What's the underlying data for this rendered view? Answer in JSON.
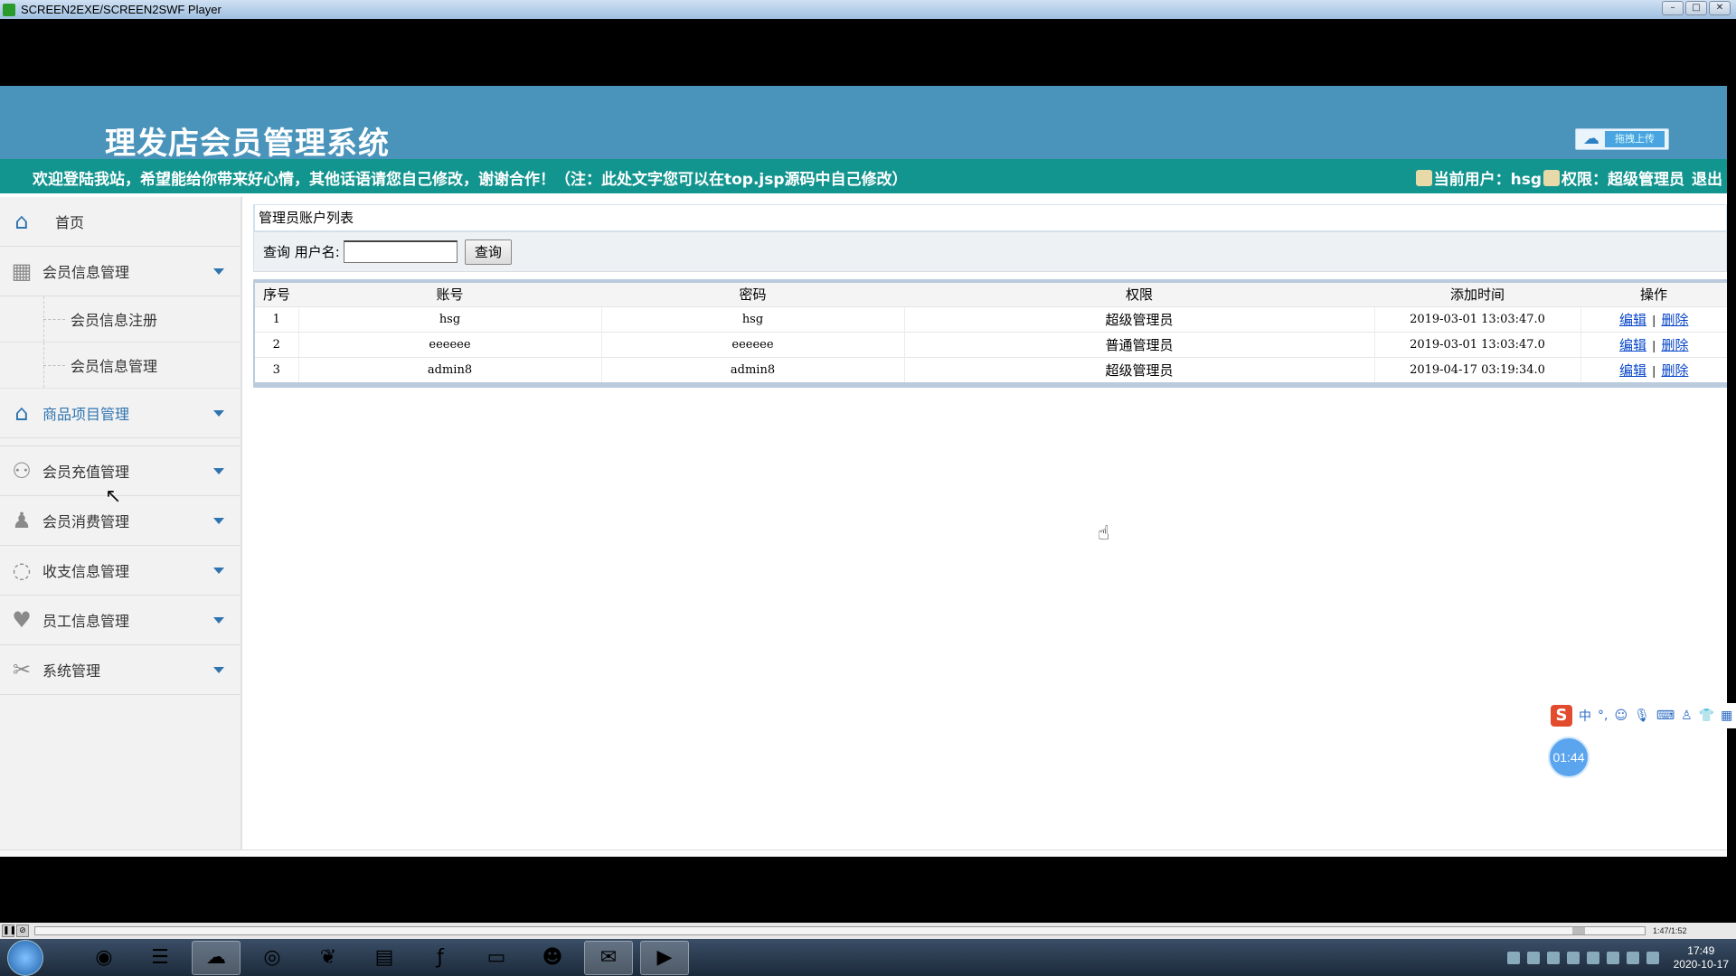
{
  "window": {
    "title": "SCREEN2EXE/SCREEN2SWF Player",
    "controls": [
      "–",
      "□",
      "✕"
    ]
  },
  "header": {
    "site_title": "理发店会员管理系统",
    "upload_label": "拖拽上传",
    "welcome": "欢迎登陆我站，希望能给你带来好心情，其他话语请您自己修改，谢谢合作！（注：此处文字您可以在top.jsp源码中自己修改）",
    "user_text": "当前用户：hsg",
    "role_text": "权限：超级管理员",
    "logout": "退出"
  },
  "sidebar": {
    "home": "首页",
    "member_info": "会员信息管理",
    "member_register": "会员信息注册",
    "member_manage": "会员信息管理",
    "product": "商品项目管理",
    "recharge": "会员充值管理",
    "consume": "会员消费管理",
    "finance": "收支信息管理",
    "staff": "员工信息管理",
    "system": "系统管理"
  },
  "panel": {
    "title": "管理员账户列表",
    "search_label": "查询  用户名:",
    "search_value": "",
    "search_button": "查询"
  },
  "table": {
    "headers": [
      "序号",
      "账号",
      "密码",
      "权限",
      "添加时间",
      "操作"
    ],
    "rows": [
      {
        "id": "1",
        "account": "hsg",
        "password": "hsg",
        "role": "超级管理员",
        "time": "2019-03-01 13:03:47.0"
      },
      {
        "id": "2",
        "account": "eeeeee",
        "password": "eeeeee",
        "role": "普通管理员",
        "time": "2019-03-01 13:03:47.0"
      },
      {
        "id": "3",
        "account": "admin8",
        "password": "admin8",
        "role": "超级管理员",
        "time": "2019-04-17 03:19:34.0"
      }
    ],
    "edit_label": "编辑",
    "delete_label": "删除",
    "separator": "|"
  },
  "widgets": {
    "timer": "01:44",
    "ime_lang": "中"
  },
  "player": {
    "time": "1:47/1:52"
  },
  "taskbar": {
    "clock_time": "17:49",
    "clock_date": "2020-10-17"
  },
  "colors": {
    "header": "#4a94bc",
    "marquee": "#13958f",
    "accent": "#2f74b0"
  }
}
